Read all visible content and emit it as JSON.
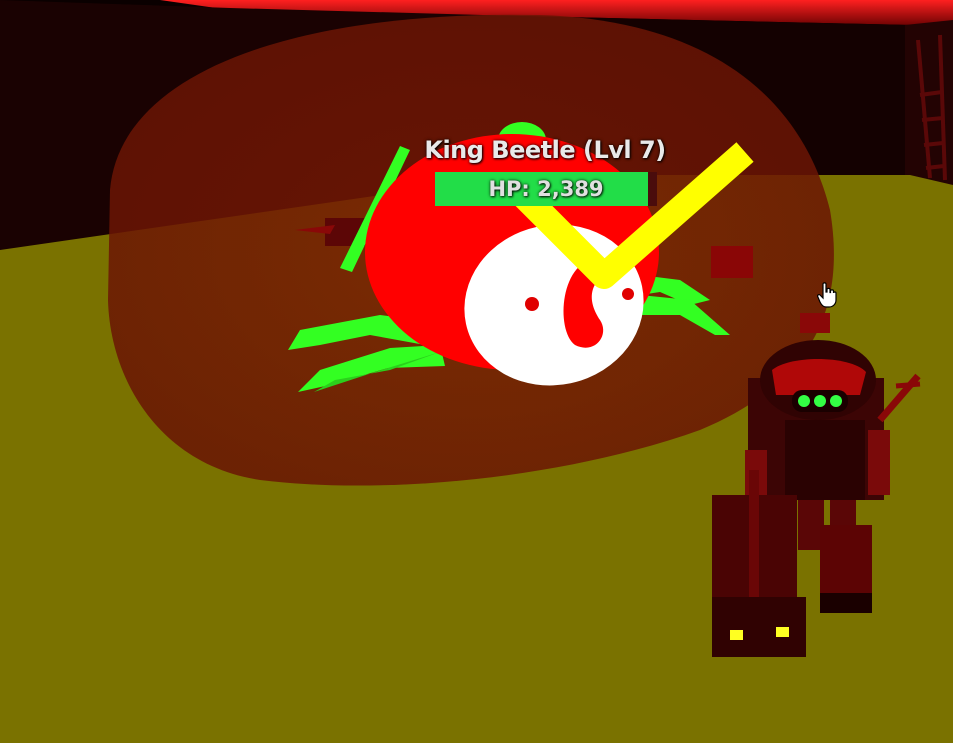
{
  "boss": {
    "name": "King Beetle (Lvl 7)",
    "hp_label": "HP: 2,389",
    "hp_fraction": 0.96
  },
  "colors": {
    "floor": "#7a7200",
    "aura": "#7a1a04",
    "beetle_body": "#ff0000",
    "beetle_limbs": "#33ff22",
    "hp_fill": "#22dd48",
    "yellow_marker": "#ffff00",
    "ceiling_glow": "#ff1a1a"
  },
  "icons": {
    "cursor": "hand-pointer-icon"
  }
}
